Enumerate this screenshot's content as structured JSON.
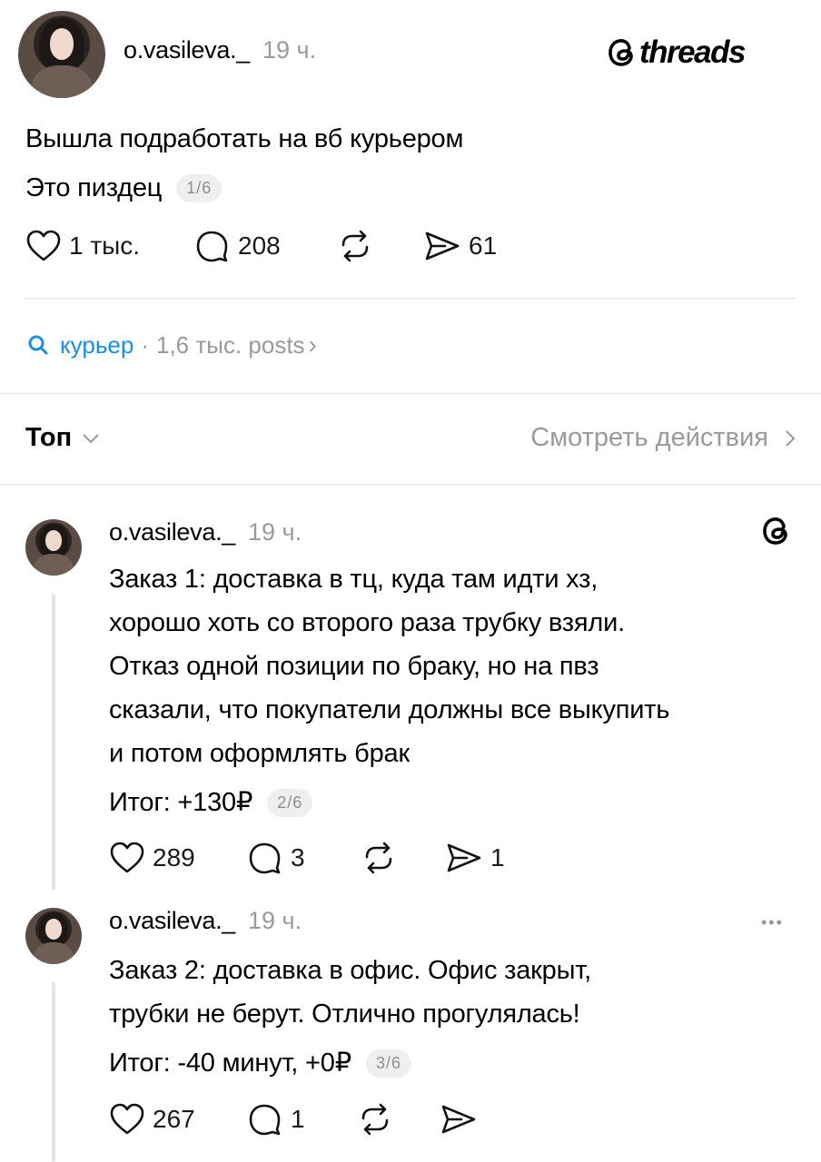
{
  "brand": {
    "wordmark": "threads"
  },
  "main_post": {
    "username": "o.vasileva._",
    "time": "19 ч.",
    "lines": [
      "Вышла подработать на вб курьером",
      "Это пиздец"
    ],
    "pager": "1/6",
    "likes": "1 тыс.",
    "replies": "208",
    "shares": "61"
  },
  "tag": {
    "name": "курьер",
    "separator": "·",
    "count": "1,6 тыс. posts",
    "chevron": "›"
  },
  "sort": {
    "label": "Топ",
    "activity_link": "Смотреть действия"
  },
  "replies": [
    {
      "username": "o.vasileva._",
      "time": "19 ч.",
      "lines": [
        "Заказ 1: доставка в тц, куда там идти хз,",
        "хорошо хоть со второго раза трубку взяли.",
        "Отказ одной позиции по браку, но на пвз",
        "сказали, что покупатели должны все выкупить",
        "и потом оформлять брак"
      ],
      "total": "Итог: +130₽",
      "pager": "2/6",
      "likes": "289",
      "replies": "3",
      "shares": "1"
    },
    {
      "username": "o.vasileva._",
      "time": "19 ч.",
      "lines": [
        "Заказ 2: доставка в офис. Офис закрыт,",
        "трубки не берут. Отлично прогулялась!"
      ],
      "total": "Итог: -40 минут, +0₽",
      "pager": "3/6",
      "likes": "267",
      "replies": "1",
      "more": "•••"
    }
  ]
}
